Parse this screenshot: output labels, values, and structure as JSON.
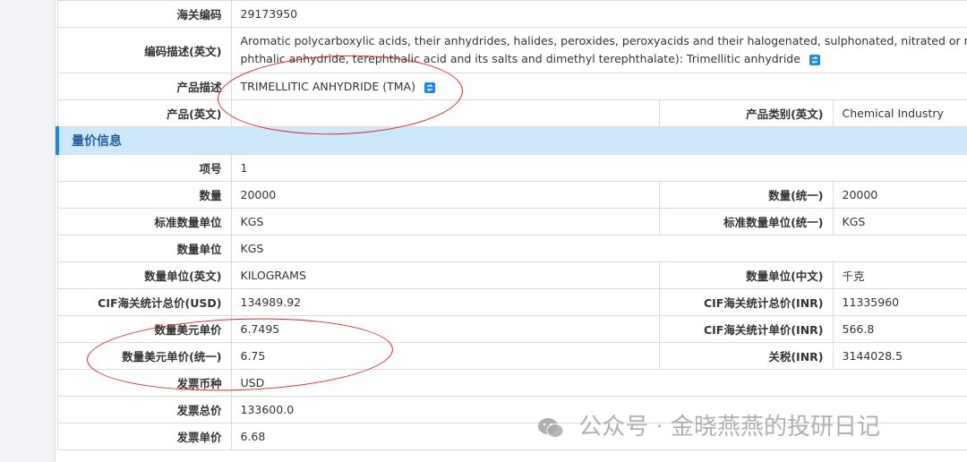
{
  "basic": {
    "hs_code_label": "海关编码",
    "hs_code": "29173950",
    "desc_en_label": "编码描述(英文)",
    "desc_en_line1": "Aromatic polycarboxylic acids, their anhydrides, halides, peroxides, peroxyacids and their halogenated, sulphonated, nitrated or nitrosated de",
    "desc_en_line2": "phthalic anhydride, terephthalic acid and its salts and dimethyl terephthalate): Trimellitic anhydride",
    "product_desc_label": "产品描述",
    "product_desc": "TRIMELLITIC ANHYDRIDE (TMA)",
    "product_en_label": "产品(英文)",
    "product_en": "",
    "category_en_label": "产品类别(英文)",
    "category_en": "Chemical Industry"
  },
  "section": {
    "title": "量价信息"
  },
  "rows": {
    "item_no_label": "项号",
    "item_no": "1",
    "qty_label": "数量",
    "qty": "20000",
    "qty_unified_label": "数量(统一)",
    "qty_unified": "20000",
    "std_unit_label": "标准数量单位",
    "std_unit": "KGS",
    "std_unit_unified_label": "标准数量单位(统一)",
    "std_unit_unified": "KGS",
    "qty_unit_label": "数量单位",
    "qty_unit": "KGS",
    "qty_unit_en_label": "数量单位(英文)",
    "qty_unit_en": "KILOGRAMS",
    "qty_unit_cn_label": "数量单位(中文)",
    "qty_unit_cn": "千克",
    "cif_total_usd_label": "CIF海关统计总价(USD)",
    "cif_total_usd": "134989.92",
    "cif_total_inr_label": "CIF海关统计总价(INR)",
    "cif_total_inr": "11335960",
    "usd_unit_price_label": "数量美元单价",
    "usd_unit_price": "6.7495",
    "cif_unit_inr_label": "CIF海关统计单价(INR)",
    "cif_unit_inr": "566.8",
    "usd_unit_price_unified_label": "数量美元单价(统一)",
    "usd_unit_price_unified": "6.75",
    "duty_inr_label": "关税(INR)",
    "duty_inr": "3144028.5",
    "invoice_currency_label": "发票币种",
    "invoice_currency": "USD",
    "invoice_total_label": "发票总价",
    "invoice_total": "133600.0",
    "invoice_unit_label": "发票单价",
    "invoice_unit": "6.68"
  },
  "watermark": {
    "text": "公众号 · 金晓燕燕的投研日记"
  },
  "icons": {
    "translate": "translate-icon",
    "wechat": "wechat-icon"
  },
  "colors": {
    "annotation": "#e02424",
    "section_bg": "#cde8fb",
    "section_accent": "#1e88e5"
  }
}
